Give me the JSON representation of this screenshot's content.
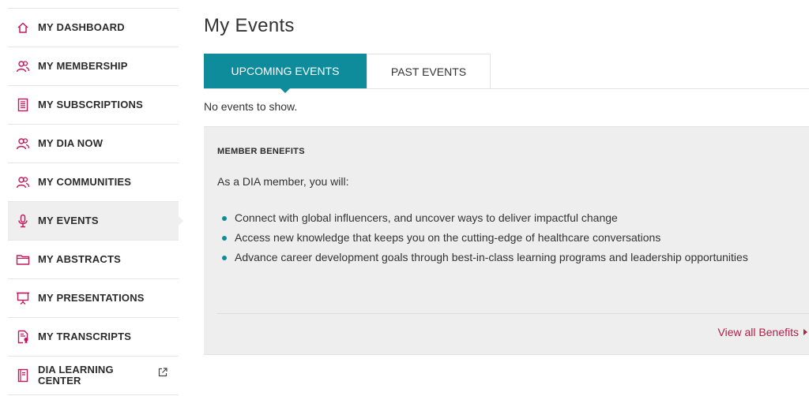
{
  "colors": {
    "accent": "#0e8c9b",
    "link": "#b1214a",
    "icon": "#c2185b",
    "panel_bg": "#eeeeee"
  },
  "sidebar": {
    "items": [
      {
        "label": "MY DASHBOARD",
        "icon": "home-icon",
        "active": false
      },
      {
        "label": "MY MEMBERSHIP",
        "icon": "members-icon",
        "active": false
      },
      {
        "label": "MY SUBSCRIPTIONS",
        "icon": "document-icon",
        "active": false
      },
      {
        "label": "MY DIA NOW",
        "icon": "members-icon",
        "active": false
      },
      {
        "label": "MY COMMUNITIES",
        "icon": "members-icon",
        "active": false
      },
      {
        "label": "MY EVENTS",
        "icon": "microphone-icon",
        "active": true
      },
      {
        "label": "MY ABSTRACTS",
        "icon": "folder-icon",
        "active": false
      },
      {
        "label": "MY PRESENTATIONS",
        "icon": "presentation-icon",
        "active": false
      },
      {
        "label": "MY TRANSCRIPTS",
        "icon": "certificate-icon",
        "active": false
      },
      {
        "label": "DIA LEARNING CENTER",
        "icon": "book-icon",
        "active": false,
        "external": true
      }
    ]
  },
  "main": {
    "title": "My Events",
    "tabs": [
      {
        "label": "UPCOMING EVENTS",
        "active": true
      },
      {
        "label": "PAST EVENTS",
        "active": false
      }
    ],
    "empty_message": "No events to show.",
    "benefits": {
      "title": "MEMBER BENEFITS",
      "intro": "As a DIA member, you will:",
      "items": [
        "Connect with global influencers, and uncover ways to deliver impactful change",
        "Access new knowledge that keeps you on the cutting-edge of healthcare conversations",
        "Advance career development goals through best-in-class learning programs and leadership opportunities"
      ],
      "link_label": "View all Benefits"
    }
  }
}
